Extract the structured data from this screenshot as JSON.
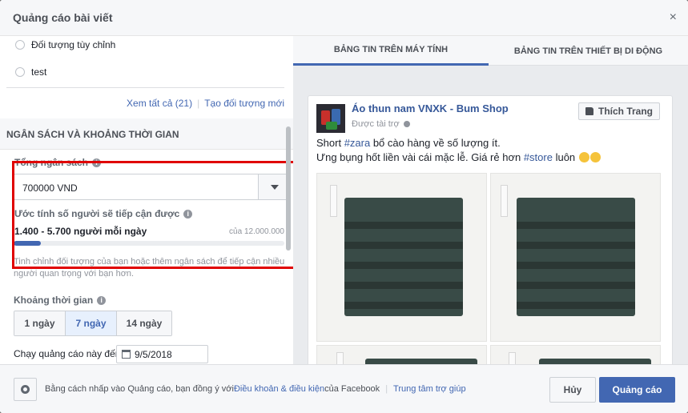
{
  "dialog": {
    "title": "Quảng cáo bài viết",
    "close_symbol": "×"
  },
  "audience": {
    "options": [
      {
        "label": "Đối tượng tùy chỉnh"
      },
      {
        "label": "test"
      }
    ],
    "see_all": "Xem tất cả (21)",
    "create": "Tạo đối tượng mới"
  },
  "budget": {
    "section_title": "NGÂN SÁCH VÀ KHOẢNG THỜI GIAN",
    "total_label": "Tổng ngân sách",
    "total_value": "700000 VND",
    "reach_label": "Ước tính số người sẽ tiếp cận được",
    "reach_range": "1.400 - 5.700 người mỗi ngày",
    "reach_max": "của 12.000.000",
    "reach_fraction": 0.1,
    "reach_note": "Tinh chỉnh đối tượng của bạn hoặc thêm ngân sách để tiếp cận nhiều người quan trọng với bạn hơn.",
    "duration_label": "Khoảng thời gian",
    "durations": [
      "1 ngày",
      "7 ngày",
      "14 ngày"
    ],
    "duration_selected": "7 ngày",
    "run_until_label": "Chạy quảng cáo này đến",
    "run_until_date": "9/5/2018"
  },
  "preview": {
    "tabs": [
      "BẢNG TIN TRÊN MÁY TÍNH",
      "BẢNG TIN TRÊN THIẾT BỊ DI ĐỘNG"
    ],
    "page_name": "Áo thun nam VNXK - Bum Shop",
    "sponsored": "Được tài trợ",
    "like_label": "Thích Trang",
    "text_line1_pre": "Short ",
    "text_line1_tag": "#zara",
    "text_line1_post": " bổ cào hàng về số lượng ít.",
    "text_line2_pre": "Ưng bụng hốt liền vài cái mặc lễ. Giá rẻ hơn ",
    "text_line2_tag": "#store",
    "text_line2_post": " luôn"
  },
  "footer": {
    "terms_pre": "Bằng cách nhấp vào Quảng cáo, bạn đồng ý với ",
    "terms_link": "Điều khoản & điều kiện",
    "terms_post": " của Facebook",
    "help_link": "Trung tâm trợ giúp",
    "cancel": "Hủy",
    "submit": "Quảng cáo"
  },
  "colors": {
    "accent": "#4267b2",
    "highlight_box": "#e00000"
  },
  "icons": [
    "close-icon",
    "info-icon",
    "chevron-down-icon",
    "calendar-icon",
    "globe-icon",
    "thumbs-up-icon",
    "gear-icon",
    "smile-emoji-icon"
  ]
}
